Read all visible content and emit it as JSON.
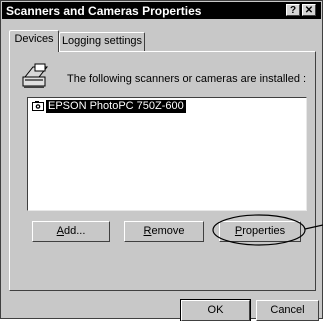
{
  "window": {
    "title": "Scanners and Cameras Properties",
    "help_button": "?",
    "close_button": "✕"
  },
  "tabs": [
    {
      "label": "Devices"
    },
    {
      "label": "Logging settings"
    }
  ],
  "devices": {
    "header": "The following scanners or cameras are installed :",
    "items": [
      {
        "label": "EPSON PhotoPC 750Z-600"
      }
    ]
  },
  "buttons": {
    "add": {
      "first": "A",
      "rest": "dd..."
    },
    "remove": {
      "first": "R",
      "rest": "emove"
    },
    "properties": {
      "first": "P",
      "rest": "roperties"
    }
  },
  "footer": {
    "ok": "OK",
    "cancel": "Cancel"
  }
}
